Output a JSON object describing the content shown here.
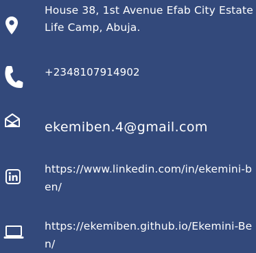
{
  "contact": {
    "address": "House 38, 1st Avenue Efab City Estate Life Camp, Abuja.",
    "phone": "+2348107914902",
    "email": "ekemiben.4@gmail.com",
    "linkedin": "https://www.linkedin.com/in/ekemini-ben/",
    "website": "https://ekemiben.github.io/Ekemini-Ben/"
  },
  "icons": {
    "address": "map-marker-icon",
    "phone": "phone-icon",
    "email": "envelope-open-icon",
    "linkedin": "linkedin-icon",
    "website": "laptop-icon"
  },
  "colors": {
    "background": "#33497b",
    "foreground": "#ffffff"
  }
}
